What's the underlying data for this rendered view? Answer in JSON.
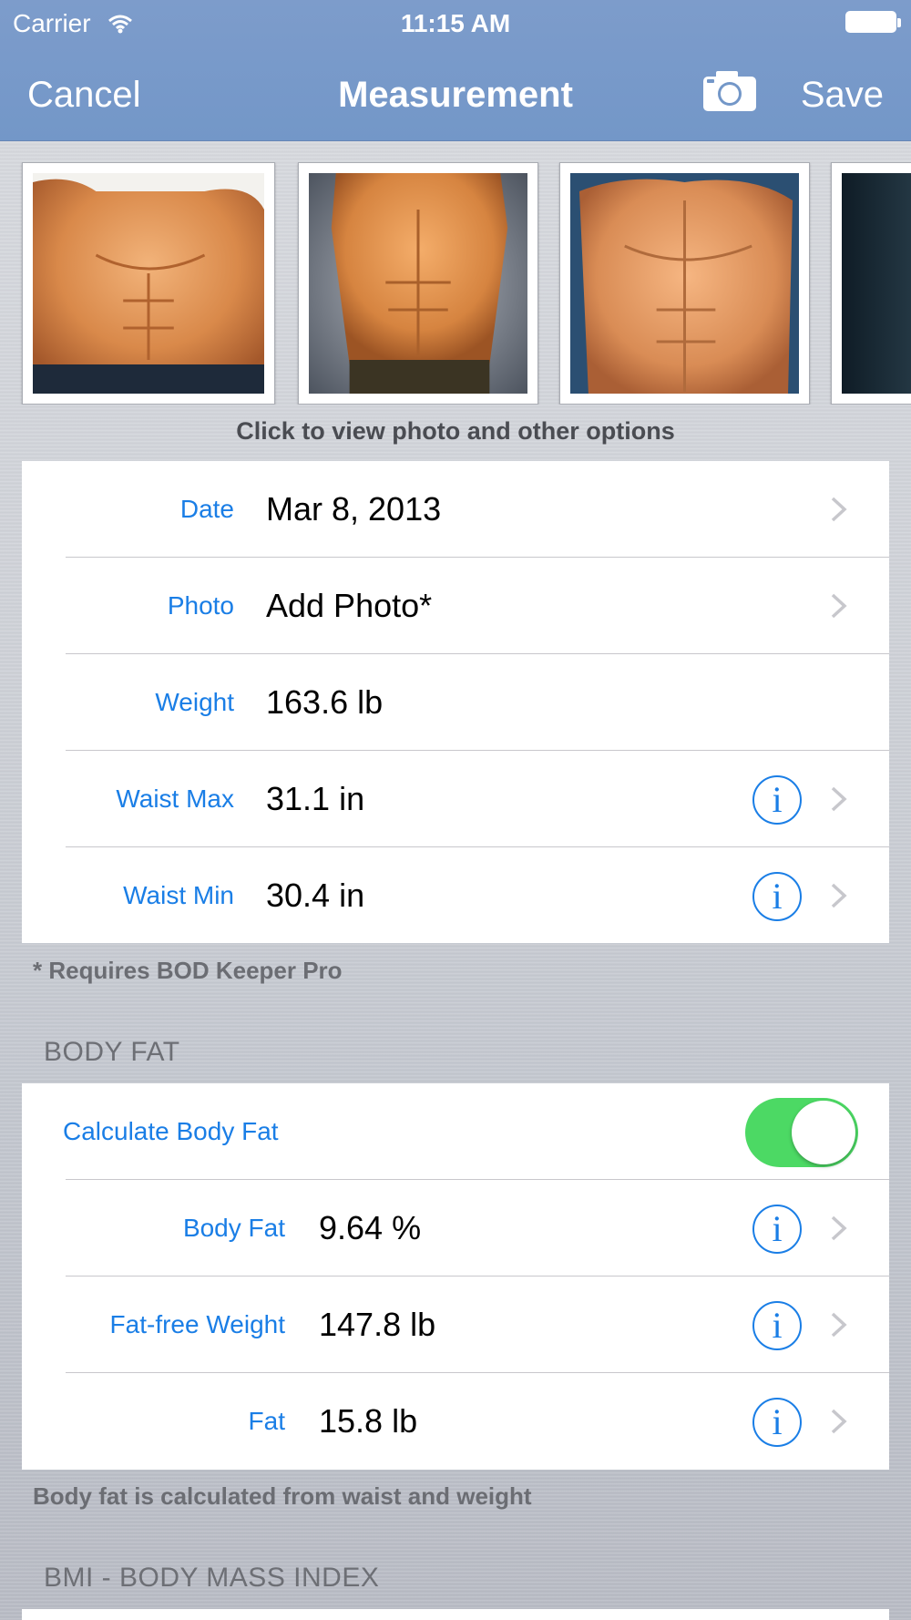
{
  "status_bar": {
    "carrier": "Carrier",
    "time": "11:15 AM"
  },
  "nav": {
    "cancel": "Cancel",
    "title": "Measurement",
    "save": "Save",
    "camera_icon": "camera-icon"
  },
  "photo_strip": {
    "caption": "Click to view photo and other options",
    "photo_count_visible": 4
  },
  "measurements": {
    "date": {
      "label": "Date",
      "value": "Mar 8, 2013"
    },
    "photo": {
      "label": "Photo",
      "value": "Add Photo*"
    },
    "weight": {
      "label": "Weight",
      "value": "163.6 lb"
    },
    "waist_max": {
      "label": "Waist Max",
      "value": "31.1 in"
    },
    "waist_min": {
      "label": "Waist Min",
      "value": "30.4 in"
    },
    "footnote": "* Requires BOD Keeper Pro"
  },
  "body_fat": {
    "header": "BODY FAT",
    "calculate_label": "Calculate Body Fat",
    "calculate_on": true,
    "body_fat": {
      "label": "Body Fat",
      "value": "9.64 %"
    },
    "fat_free_weight": {
      "label": "Fat-free Weight",
      "value": "147.8 lb"
    },
    "fat": {
      "label": "Fat",
      "value": "15.8 lb"
    },
    "footnote": "Body fat is calculated from waist and weight"
  },
  "bmi": {
    "header": "BMI - BODY MASS INDEX"
  },
  "colors": {
    "nav_bar": "#7397c8",
    "accent": "#1a7ee6",
    "toggle_on": "#4cd964"
  },
  "info_glyph": "i"
}
